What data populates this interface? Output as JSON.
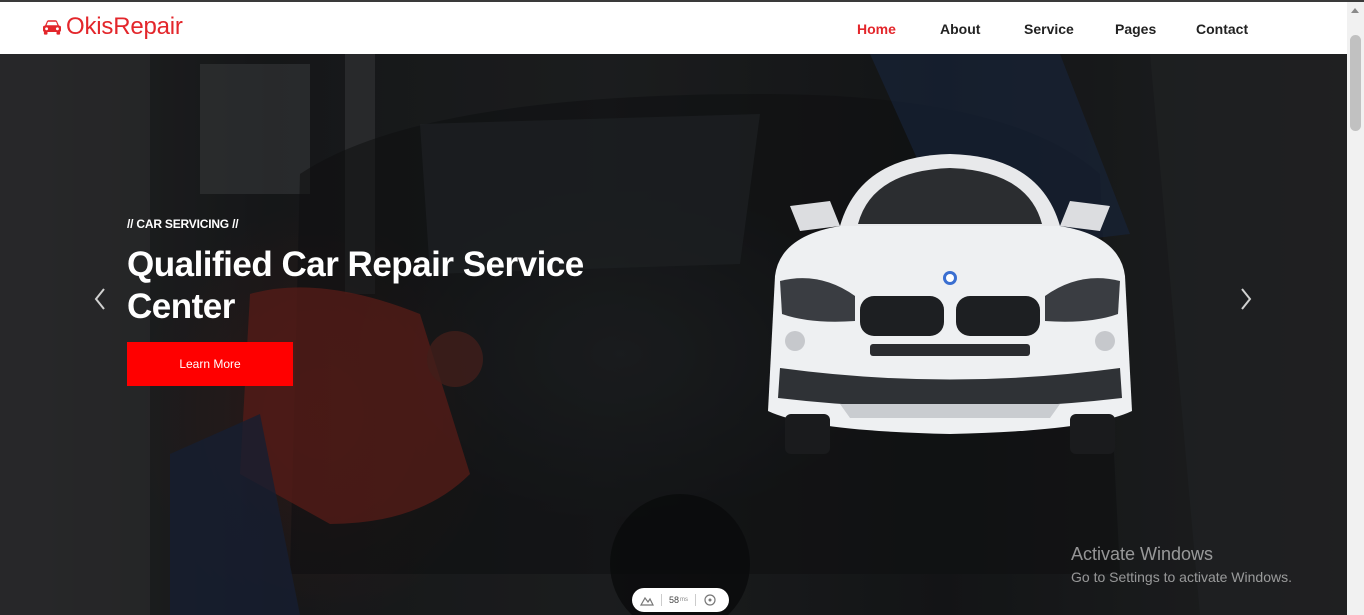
{
  "brand": {
    "name": "OkisRepair",
    "icon": "car-icon",
    "color": "#e3262b"
  },
  "nav": {
    "items": [
      {
        "label": "Home",
        "active": true
      },
      {
        "label": "About",
        "active": false
      },
      {
        "label": "Service",
        "active": false
      },
      {
        "label": "Pages",
        "active": false
      },
      {
        "label": "Contact",
        "active": false
      }
    ]
  },
  "hero": {
    "eyebrow": "// CAR SERVICING //",
    "headline": "Qualified Car Repair Service Center",
    "cta_label": "Learn More",
    "cta_color": "#ff0000",
    "prev_icon": "chevron-left-icon",
    "next_icon": "chevron-right-icon"
  },
  "watermark": {
    "title": "Activate Windows",
    "subtitle": "Go to Settings to activate Windows."
  },
  "perf_widget": {
    "value": "58",
    "unit": "ms"
  }
}
